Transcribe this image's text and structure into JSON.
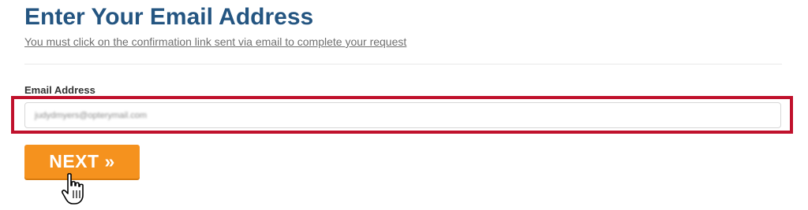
{
  "header": {
    "title": "Enter Your Email Address",
    "subtitle": "You must click on the confirmation link sent via email to complete your request"
  },
  "form": {
    "email_label": "Email Address",
    "email_value": "judydmyers@opterymail.com",
    "next_label": "NEXT »"
  },
  "colors": {
    "title": "#245581",
    "highlight": "#c0112c",
    "button": "#f5921e"
  },
  "icons": {
    "cursor": "hand-pointer-icon"
  }
}
